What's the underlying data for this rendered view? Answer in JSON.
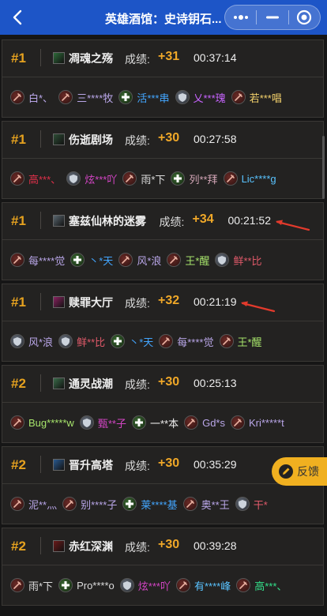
{
  "header": {
    "title": "英雄酒馆：史诗钥石...",
    "back_icon": "chevron-left-icon",
    "more_icon": "more-dots-icon",
    "minimize_icon": "minimize-icon",
    "close_icon": "target-circle-icon"
  },
  "score_label": "成绩:",
  "colors": {
    "header_bg": "#1d55c7",
    "rank": "#e6a21f",
    "score": "#f0a828",
    "annotation_arrow": "#e23a2c"
  },
  "runs": [
    {
      "rank": "#1",
      "dungeon": "凋魂之殇",
      "score": "+31",
      "time": "00:37:14",
      "members": [
        {
          "role": "dps",
          "name": "白*、",
          "color": "#b9a6e8"
        },
        {
          "role": "dps",
          "name": "三****牧",
          "color": "#b9a6e8"
        },
        {
          "role": "heal",
          "name": "活***串",
          "color": "#43a6ff"
        },
        {
          "role": "tank",
          "name": "乂***瑰",
          "color": "#c864ff"
        },
        {
          "role": "dps",
          "name": "若***唱",
          "color": "#f2d06b"
        }
      ]
    },
    {
      "rank": "#1",
      "dungeon": "伤逝剧场",
      "score": "+30",
      "time": "00:27:58",
      "members": [
        {
          "role": "dps",
          "name": "高***、",
          "color": "#e0304a"
        },
        {
          "role": "tank",
          "name": "炫***吖",
          "color": "#d445c5"
        },
        {
          "role": "dps",
          "name": "雨*下",
          "color": "#dcdcdc"
        },
        {
          "role": "heal",
          "name": "列**拜",
          "color": "#d5a7b8"
        },
        {
          "role": "dps",
          "name": "Lic****g",
          "color": "#59c3ff"
        }
      ]
    },
    {
      "rank": "#1",
      "dungeon": "塞兹仙林的迷雾",
      "score": "+34",
      "time": "00:21:52",
      "arrow": true,
      "members": [
        {
          "role": "dps",
          "name": "每****觉",
          "color": "#b9a6e8"
        },
        {
          "role": "heal",
          "name": "丶*天",
          "color": "#43a6ff"
        },
        {
          "role": "dps",
          "name": "风*浪",
          "color": "#b9a6e8"
        },
        {
          "role": "dps",
          "name": "王*醒",
          "color": "#a6e36b"
        },
        {
          "role": "tank",
          "name": "鲜**比",
          "color": "#e05a6a"
        }
      ]
    },
    {
      "rank": "#1",
      "dungeon": "赎罪大厅",
      "score": "+32",
      "time": "00:21:19",
      "arrow": true,
      "members": [
        {
          "role": "tank",
          "name": "风*浪",
          "color": "#b9a6e8"
        },
        {
          "role": "tank",
          "name": "鲜**比",
          "color": "#e05a6a"
        },
        {
          "role": "heal",
          "name": "丶*天",
          "color": "#43a6ff"
        },
        {
          "role": "dps",
          "name": "每****觉",
          "color": "#b9a6e8"
        },
        {
          "role": "dps",
          "name": "王*醒",
          "color": "#a6e36b"
        }
      ]
    },
    {
      "rank": "#2",
      "dungeon": "通灵战潮",
      "score": "+30",
      "time": "00:25:13",
      "members": [
        {
          "role": "dps",
          "name": "Bug*****w",
          "color": "#a6e36b"
        },
        {
          "role": "tank",
          "name": "甄**子",
          "color": "#d445c5"
        },
        {
          "role": "heal",
          "name": "一**本",
          "color": "#eeeeee"
        },
        {
          "role": "dps",
          "name": "Gd*s",
          "color": "#b9a6e8"
        },
        {
          "role": "dps",
          "name": "Kri*****t",
          "color": "#b9a6e8"
        }
      ]
    },
    {
      "rank": "#2",
      "dungeon": "晋升高塔",
      "score": "+30",
      "time": "00:35:29",
      "members": [
        {
          "role": "dps",
          "name": "泥**灬",
          "color": "#b9a6e8"
        },
        {
          "role": "dps",
          "name": "别****子",
          "color": "#b9a6e8"
        },
        {
          "role": "heal",
          "name": "莱****基",
          "color": "#43a6ff"
        },
        {
          "role": "dps",
          "name": "奥**王",
          "color": "#b9a6e8"
        },
        {
          "role": "tank",
          "name": "干*",
          "color": "#e05a6a"
        }
      ]
    },
    {
      "rank": "#2",
      "dungeon": "赤红深渊",
      "score": "+30",
      "time": "00:39:28",
      "members": [
        {
          "role": "dps",
          "name": "雨*下",
          "color": "#dcdcdc"
        },
        {
          "role": "heal",
          "name": "Pro****o",
          "color": "#dcdcdc"
        },
        {
          "role": "tank",
          "name": "炫***吖",
          "color": "#d445c5"
        },
        {
          "role": "dps",
          "name": "有****峰",
          "color": "#59c3ff"
        },
        {
          "role": "dps",
          "name": "高***、",
          "color": "#33e08a"
        }
      ]
    }
  ],
  "feedback": {
    "label": "反馈",
    "icon": "pencil-icon"
  }
}
